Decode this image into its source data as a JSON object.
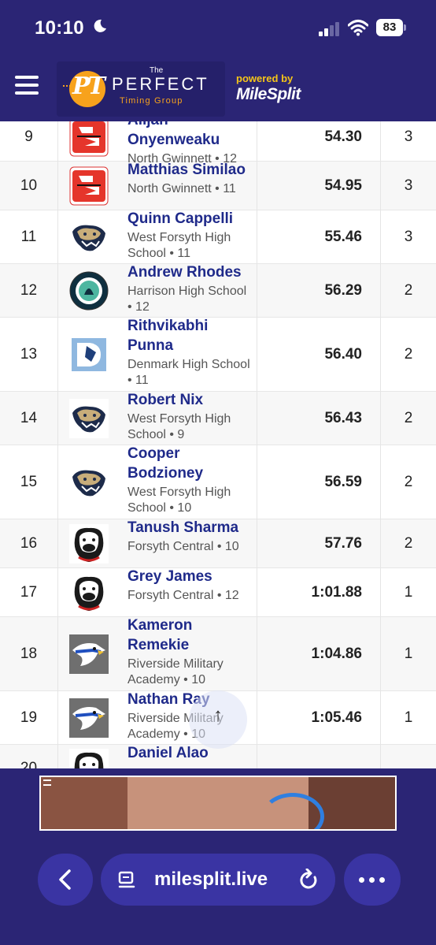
{
  "status_bar": {
    "time": "10:10",
    "battery": "83",
    "icons": [
      "moon-icon",
      "signal-icon",
      "wifi-icon",
      "battery-icon"
    ]
  },
  "header": {
    "logo_the": "The",
    "logo_perfect": "PERFECT",
    "logo_timing": "Timing Group",
    "logo_pt": "PT",
    "powered_by": "powered by",
    "milesplit": "MileSplit"
  },
  "results": [
    {
      "place": "9",
      "name": "Alijah Onyenweaku",
      "team": "North Gwinnett • 12",
      "mark": "54.30",
      "points": "3",
      "logo": "north-gwinnett-logo"
    },
    {
      "place": "10",
      "name": "Matthias Similao",
      "team": "North Gwinnett • 11",
      "mark": "54.95",
      "points": "3",
      "logo": "north-gwinnett-logo"
    },
    {
      "place": "11",
      "name": "Quinn Cappelli",
      "team": "West Forsyth High School • 11",
      "mark": "55.46",
      "points": "3",
      "logo": "west-forsyth-logo"
    },
    {
      "place": "12",
      "name": "Andrew Rhodes",
      "team": "Harrison High School • 12",
      "mark": "56.29",
      "points": "2",
      "logo": "harrison-logo"
    },
    {
      "place": "13",
      "name": "Rithvikabhi Punna",
      "team": "Denmark High School • 11",
      "mark": "56.40",
      "points": "2",
      "logo": "denmark-logo"
    },
    {
      "place": "14",
      "name": "Robert Nix",
      "team": "West Forsyth High School • 9",
      "mark": "56.43",
      "points": "2",
      "logo": "west-forsyth-logo"
    },
    {
      "place": "15",
      "name": "Cooper Bodzioney",
      "team": "West Forsyth High School • 10",
      "mark": "56.59",
      "points": "2",
      "logo": "west-forsyth-logo"
    },
    {
      "place": "16",
      "name": "Tanush Sharma",
      "team": "Forsyth Central • 10",
      "mark": "57.76",
      "points": "2",
      "logo": "forsyth-central-logo"
    },
    {
      "place": "17",
      "name": "Grey James",
      "team": "Forsyth Central • 12",
      "mark": "1:01.88",
      "points": "1",
      "logo": "forsyth-central-logo"
    },
    {
      "place": "18",
      "name": "Kameron Remekie",
      "team": "Riverside Military Academy • 10",
      "mark": "1:04.86",
      "points": "1",
      "logo": "riverside-military-logo"
    },
    {
      "place": "19",
      "name": "Nathan Ray",
      "team": "Riverside Military Academy • 10",
      "mark": "1:05.46",
      "points": "1",
      "logo": "riverside-military-logo"
    },
    {
      "place": "20",
      "name": "Daniel Alao",
      "team": "",
      "mark": "",
      "points": "",
      "logo": "forsyth-central-logo"
    }
  ],
  "scroll_top": {
    "icon": "arrow-up-icon",
    "glyph": "↑"
  },
  "browser": {
    "url": "milesplit.live",
    "icons": [
      "back-icon",
      "page-icon",
      "reload-icon",
      "more-icon"
    ]
  },
  "colors": {
    "header_bg": "#2b2575",
    "name_text": "#1f2a8a",
    "accent_orange": "#f7a21c",
    "accent_yellow": "#f5c518"
  }
}
